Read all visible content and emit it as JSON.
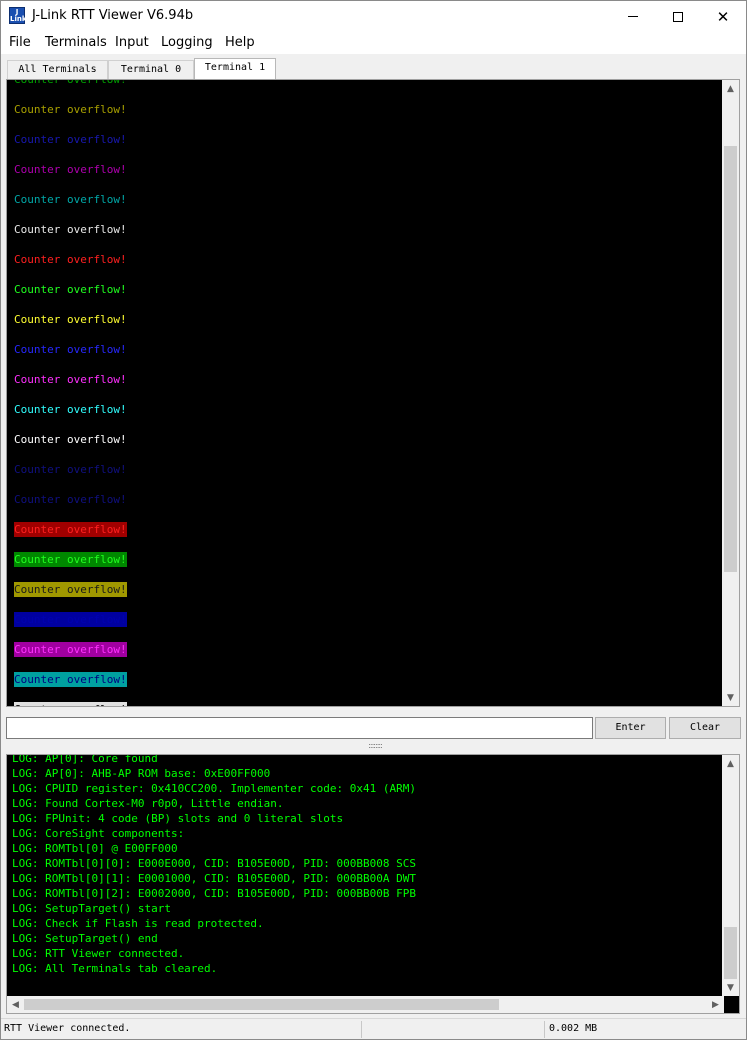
{
  "window": {
    "title": "J-Link RTT Viewer V6.94b",
    "icon_text": "J Link",
    "controls": [
      "minimize-icon",
      "maximize-icon",
      "close-icon"
    ]
  },
  "menu": [
    "File",
    "Terminals",
    "Input",
    "Logging",
    "Help"
  ],
  "tabs": [
    {
      "label": "All Terminals",
      "active": false
    },
    {
      "label": "Terminal 0",
      "active": false
    },
    {
      "label": "Terminal 1",
      "active": true
    }
  ],
  "terminal": {
    "lines": [
      {
        "text": "Counter overflow!",
        "fg": "#00a000",
        "bg": ""
      },
      {
        "text": "Counter overflow!",
        "fg": "#a8a000",
        "bg": ""
      },
      {
        "text": "Counter overflow!",
        "fg": "#1818b0",
        "bg": ""
      },
      {
        "text": "Counter overflow!",
        "fg": "#b000b0",
        "bg": ""
      },
      {
        "text": "Counter overflow!",
        "fg": "#00a8a8",
        "bg": ""
      },
      {
        "text": "Counter overflow!",
        "fg": "#e8e8e8",
        "bg": ""
      },
      {
        "text": "Counter overflow!",
        "fg": "#ff2020",
        "bg": ""
      },
      {
        "text": "Counter overflow!",
        "fg": "#20ff20",
        "bg": ""
      },
      {
        "text": "Counter overflow!",
        "fg": "#ffff30",
        "bg": ""
      },
      {
        "text": "Counter overflow!",
        "fg": "#2828ff",
        "bg": ""
      },
      {
        "text": "Counter overflow!",
        "fg": "#ff30ff",
        "bg": ""
      },
      {
        "text": "Counter overflow!",
        "fg": "#30ffff",
        "bg": ""
      },
      {
        "text": "Counter overflow!",
        "fg": "#ffffff",
        "bg": ""
      },
      {
        "text": "Counter overflow!",
        "fg": "#101080",
        "bg": ""
      },
      {
        "text": "Counter overflow!",
        "fg": "#101080",
        "bg": ""
      },
      {
        "text": "Counter overflow!",
        "fg": "#ff2020",
        "bg": "#a00000"
      },
      {
        "text": "Counter overflow!",
        "fg": "#20ff20",
        "bg": "#008800"
      },
      {
        "text": "Counter overflow!",
        "fg": "#1a1a1a",
        "bg": "#a09800"
      },
      {
        "text": "Counter overflow!",
        "fg": "#0000b0",
        "bg": "#0000a0"
      },
      {
        "text": "Counter overflow!",
        "fg": "#ff30ff",
        "bg": "#a000a0"
      },
      {
        "text": "Counter overflow!",
        "fg": "#000080",
        "bg": "#00a0a0"
      },
      {
        "text": "Counter overflow!",
        "fg": "#000000",
        "bg": "#e0e0e0"
      }
    ],
    "scroll_up_icon": "scroll-up-icon",
    "scroll_down_icon": "scroll-down-icon"
  },
  "input": {
    "value": "",
    "enter_label": "Enter",
    "clear_label": "Clear"
  },
  "splitter_grip": "::::::::",
  "log": {
    "lines": [
      "LOG: AP[0]: Core found",
      "LOG: AP[0]: AHB-AP ROM base: 0xE00FF000",
      "LOG: CPUID register: 0x410CC200. Implementer code: 0x41 (ARM)",
      "LOG: Found Cortex-M0 r0p0, Little endian.",
      "LOG: FPUnit: 4 code (BP) slots and 0 literal slots",
      "LOG: CoreSight components:",
      "LOG: ROMTbl[0] @ E00FF000",
      "LOG: ROMTbl[0][0]: E000E000, CID: B105E00D, PID: 000BB008 SCS",
      "LOG: ROMTbl[0][1]: E0001000, CID: B105E00D, PID: 000BB00A DWT",
      "LOG: ROMTbl[0][2]: E0002000, CID: B105E00D, PID: 000BB00B FPB",
      "LOG: SetupTarget() start",
      "LOG: Check if Flash is read protected.",
      "LOG: SetupTarget() end",
      "LOG: RTT Viewer connected.",
      "LOG: All Terminals tab cleared."
    ],
    "text_color": "#00ff00"
  },
  "status": {
    "message": "RTT Viewer connected.",
    "size": "0.002 MB"
  }
}
